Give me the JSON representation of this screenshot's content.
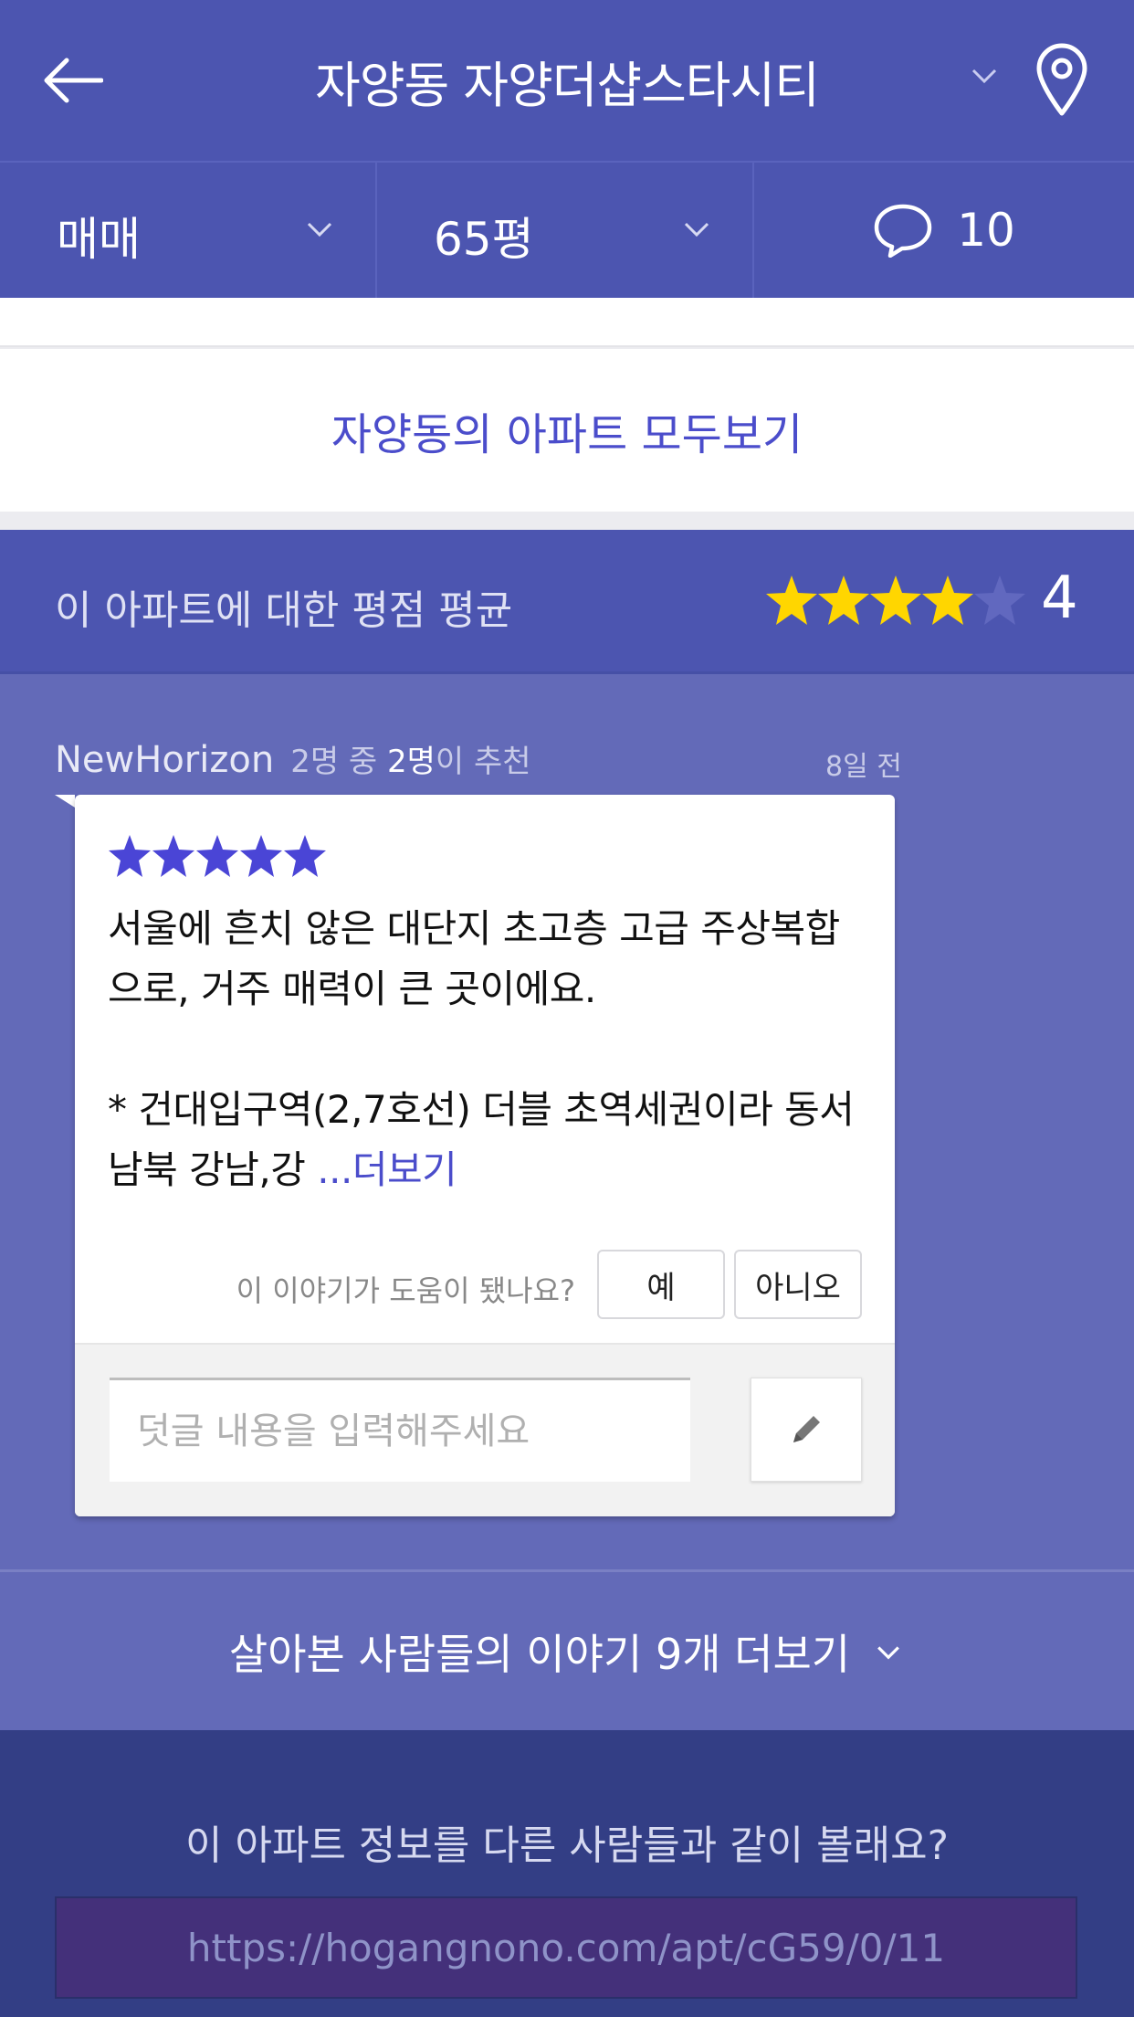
{
  "header": {
    "title": "자양동 자양더샵스타시티",
    "back_icon": "arrow-left-icon",
    "location_icon": "map-pin-icon"
  },
  "filters": {
    "trade_type": "매매",
    "size": "65평",
    "comment_count": "10"
  },
  "see_all": "자양동의 아파트 모두보기",
  "rating": {
    "label": "이 아파트에 대한 평점 평균",
    "average": "4",
    "average_stars": 4,
    "max_stars": 5
  },
  "review": {
    "author": "NewHorizon",
    "recommend_prefix": "2명 중 ",
    "recommend_count": "2명",
    "recommend_suffix": "이 추천",
    "age": "8일 전",
    "stars": 5,
    "text_p1": "서울에 흔치 않은 대단지 초고층 고급 주상복합으로, 거주 매력이 큰 곳이에요.",
    "text_p2": "* 건대입구역(2,7호선) 더블 초역세권이라 동서남북 강남,강 ",
    "more_link": "...더보기",
    "helpful_question": "이 이야기가 도움이 됐나요?",
    "yes_label": "예",
    "no_label": "아니오",
    "comment_placeholder": "덧글 내용을 입력해주세요"
  },
  "more_stories": "살아본 사람들의 이야기 9개 더보기",
  "share": {
    "question": "이 아파트 정보를 다른 사람들과 같이 볼래요?",
    "url": "https://hogangnono.com/apt/cG59/0/11"
  },
  "colors": {
    "primary": "#4c55b0",
    "review_bg": "#636ab8",
    "share_bg": "#333e85",
    "star_yellow": "#ffd600",
    "star_blue": "#4a45d6",
    "link": "#4b4dcb"
  }
}
